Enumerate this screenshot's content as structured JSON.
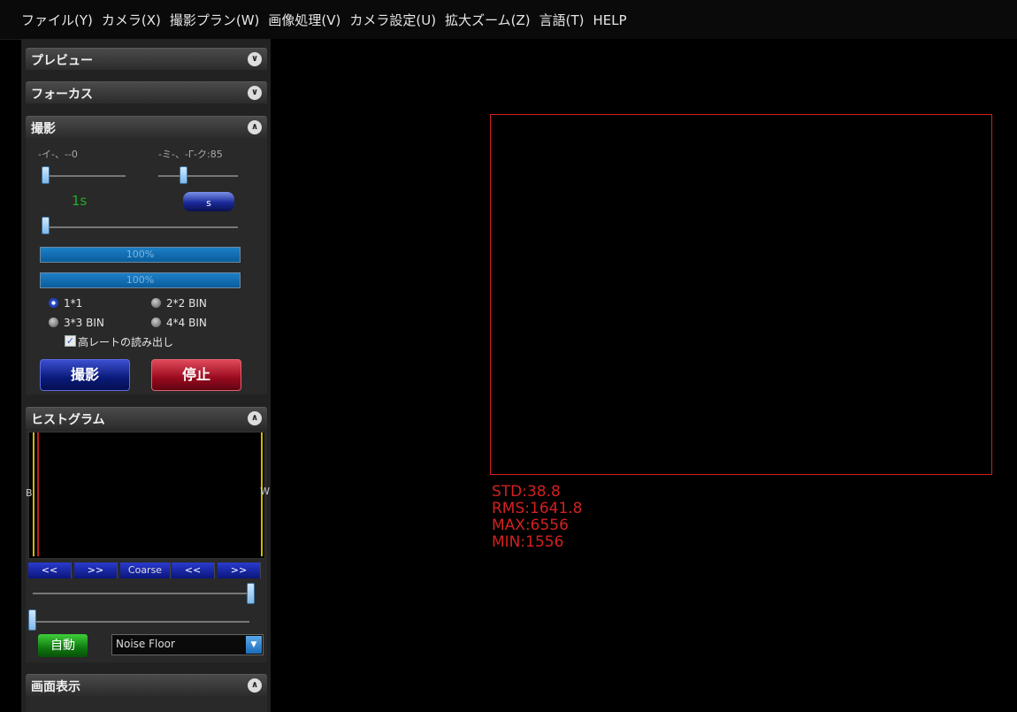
{
  "menu": {
    "items": [
      "ファイル(Y)",
      "カメラ(X)",
      "撮影プラン(W)",
      "画像処理(V)",
      "カメラ設定(U)",
      "拡大ズーム(Z)",
      "言語(T)",
      "HELP"
    ]
  },
  "sections": {
    "preview": {
      "title": "プレビュー"
    },
    "focus": {
      "title": "フォーカス"
    },
    "capture": {
      "title": "撮影",
      "gain_label": "-イ-、--0",
      "offset_label": "-ミ-、-Γ-ク:85",
      "exposure_value": "1s",
      "unit_button": "s",
      "progress1": "100%",
      "progress2": "100%",
      "progress1_fill": 1.0,
      "progress2_fill": 1.0,
      "binning": [
        "1*1",
        "2*2 BIN",
        "3*3 BIN",
        "4*4 BIN"
      ],
      "binning_selected": "1*1",
      "highrate_checkbox": "高レートの読み出し",
      "highrate_checked": true,
      "start_button": "撮影",
      "stop_button": "停止"
    },
    "histogram": {
      "title": "ヒストグラム",
      "black_marker": "B",
      "white_marker": "W",
      "nav": [
        "<<",
        ">>",
        "Coarse",
        "<<",
        ">>"
      ],
      "auto_button": "自動",
      "mode_select": "Noise Floor"
    },
    "display": {
      "title": "画面表示"
    }
  },
  "stats": {
    "std": "STD:38.8",
    "rms": "RMS:1641.8",
    "max": "MAX:6556",
    "min": "MIN:1556"
  },
  "colors": {
    "accent_red": "#d42020",
    "progress_blue": "#1d7fc6",
    "exposure_green": "#1fae2a"
  },
  "icons": {
    "collapse": "chevron-double-down-icon",
    "expand": "chevron-double-up-icon",
    "dropdown": "dropdown-arrow-icon",
    "check": "checkmark-icon"
  }
}
